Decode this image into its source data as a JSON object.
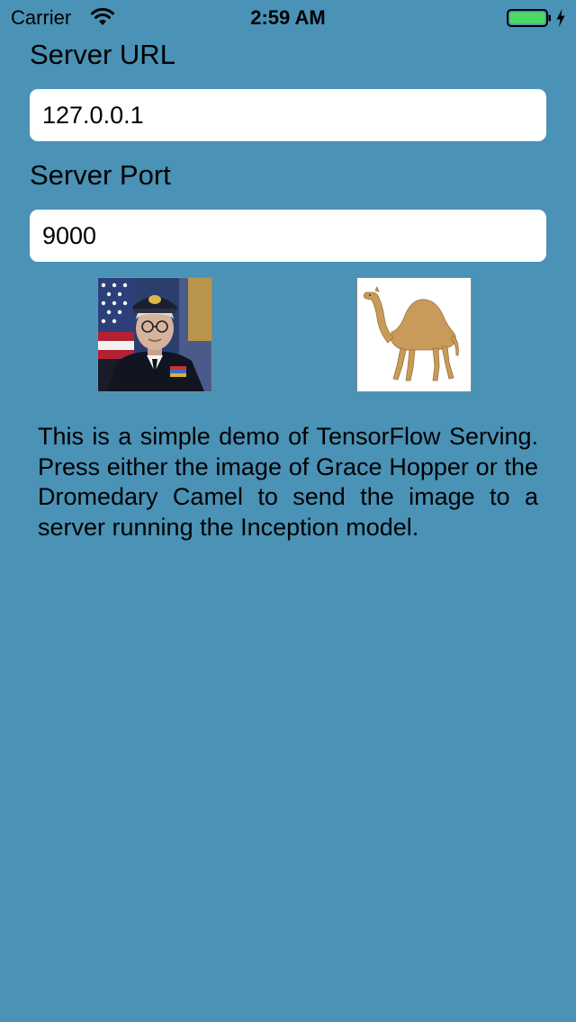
{
  "status_bar": {
    "carrier": "Carrier",
    "time": "2:59 AM",
    "battery_color": "#4CD964"
  },
  "form": {
    "server_url_label": "Server URL",
    "server_url_value": "127.0.0.1",
    "server_port_label": "Server Port",
    "server_port_value": "9000"
  },
  "images": {
    "hopper_icon": "grace-hopper-portrait",
    "camel_icon": "dromedary-camel"
  },
  "description": "This is a simple demo of TensorFlow Serving. Press either the image of Grace Hopper or the Dromedary Camel to send the image to a server running the Inception model.",
  "colors": {
    "background": "#4A92B6",
    "field_background": "#FFFFFF",
    "text": "#000000"
  }
}
